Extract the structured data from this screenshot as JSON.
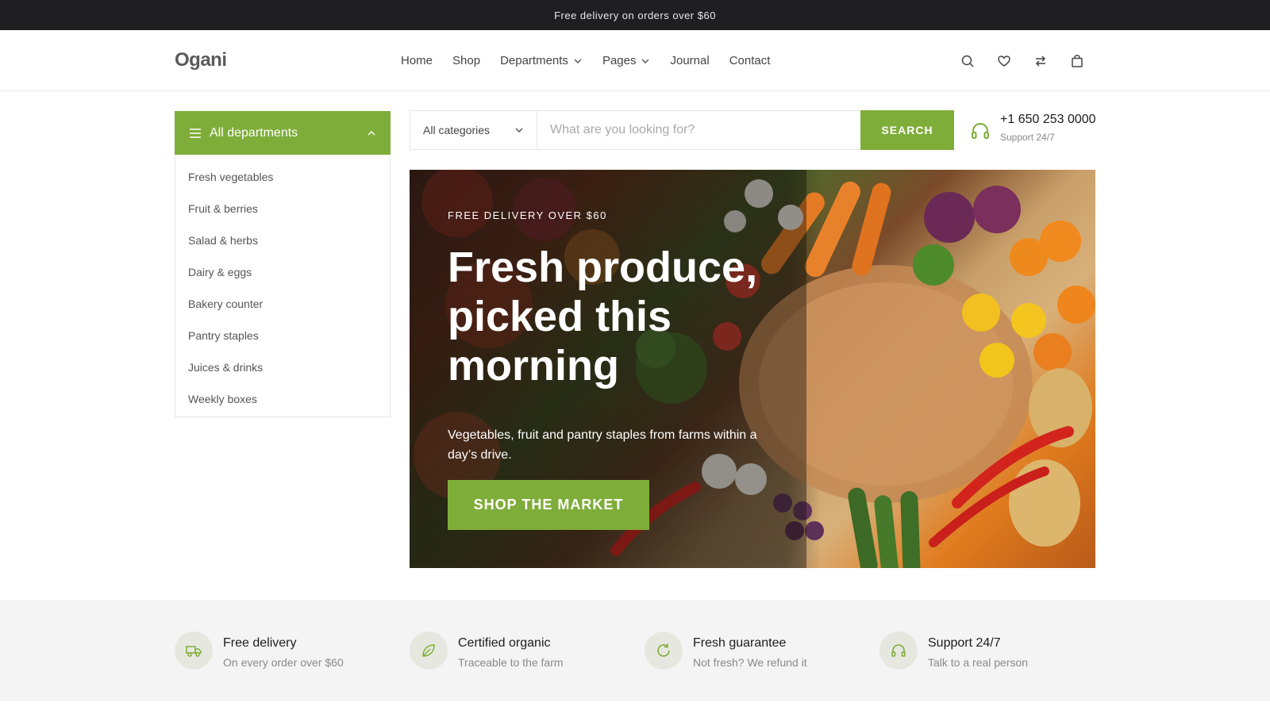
{
  "topbar": {
    "text": "Free delivery on orders over $60"
  },
  "header": {
    "logo": "Ogani",
    "nav": [
      {
        "label": "Home",
        "dropdown": false
      },
      {
        "label": "Shop",
        "dropdown": false
      },
      {
        "label": "Departments",
        "dropdown": true
      },
      {
        "label": "Pages",
        "dropdown": true
      },
      {
        "label": "Journal",
        "dropdown": false
      },
      {
        "label": "Contact",
        "dropdown": false
      }
    ],
    "icons": [
      "search-icon",
      "heart-icon",
      "compare-icon",
      "bag-icon"
    ]
  },
  "sidebar": {
    "title": "All departments",
    "items": [
      {
        "label": "Fresh vegetables"
      },
      {
        "label": "Fruit & berries"
      },
      {
        "label": "Salad & herbs"
      },
      {
        "label": "Dairy & eggs"
      },
      {
        "label": "Bakery counter"
      },
      {
        "label": "Pantry staples"
      },
      {
        "label": "Juices & drinks"
      },
      {
        "label": "Weekly boxes"
      }
    ]
  },
  "search": {
    "category": "All categories",
    "placeholder": "What are you looking for?",
    "value": "",
    "button": "SEARCH"
  },
  "support": {
    "phone": "+1 650 253 0000",
    "label": "Support 24/7"
  },
  "hero": {
    "eyebrow": "FREE DELIVERY OVER $60",
    "title": "Fresh produce, picked this morning",
    "description": "Vegetables, fruit and pantry staples from farms within a day’s drive.",
    "button": "SHOP THE MARKET"
  },
  "features": [
    {
      "icon": "truck-icon",
      "title": "Free delivery",
      "subtitle": "On every order over $60"
    },
    {
      "icon": "leaf-icon",
      "title": "Certified organic",
      "subtitle": "Traceable to the farm"
    },
    {
      "icon": "refresh-icon",
      "title": "Fresh guarantee",
      "subtitle": "Not fresh? We refund it"
    },
    {
      "icon": "headphones-icon",
      "title": "Support 24/7",
      "subtitle": "Talk to a real person"
    }
  ],
  "colors": {
    "accent": "#7fad39",
    "topbar": "#1f1f22",
    "features_bg": "#f4f4f5"
  }
}
